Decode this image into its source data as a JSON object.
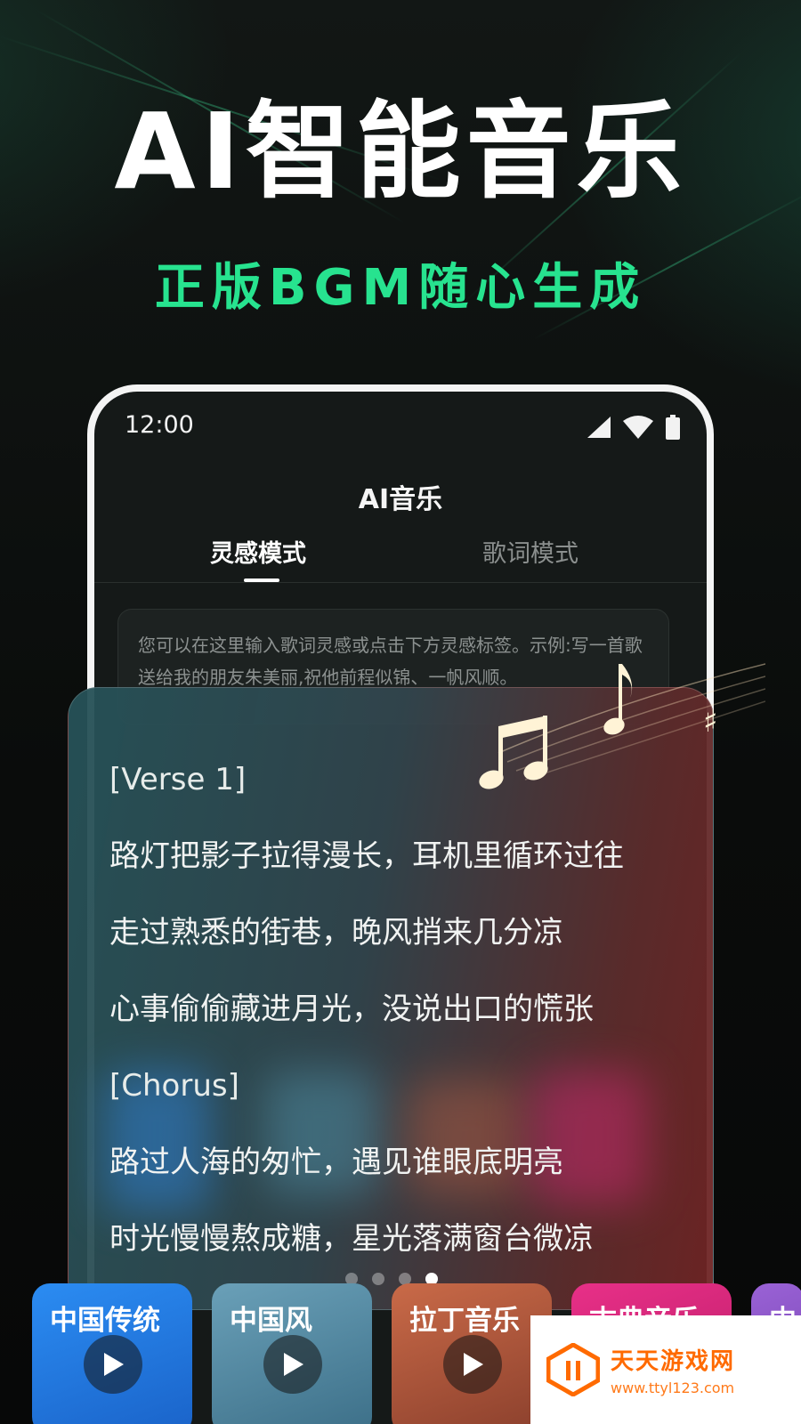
{
  "hero": {
    "title": "AI智能音乐",
    "subtitle": "正版BGM随心生成"
  },
  "status_bar": {
    "time": "12:00",
    "icons": [
      "signal-icon",
      "wifi-icon",
      "battery-icon"
    ]
  },
  "app": {
    "title": "AI音乐",
    "tabs": [
      {
        "label": "灵感模式",
        "active": true
      },
      {
        "label": "歌词模式",
        "active": false
      }
    ],
    "input_placeholder": "您可以在这里输入歌词灵感或点击下方灵感标签。示例:写一首歌送给我的朋友朱美丽,祝他前程似锦、一帆风顺。"
  },
  "lyrics": {
    "lines": [
      "[Verse 1]",
      "路灯把影子拉得漫长，耳机里循环过往",
      "走过熟悉的街巷，晚风捎来几分凉",
      "心事偷偷藏进月光，没说出口的慌张",
      "[Chorus]",
      "路过人海的匆忙，遇见谁眼底明亮",
      "时光慢慢熬成糖，星光落满窗台微凉"
    ]
  },
  "pagination": {
    "count": 4,
    "active_index": 3
  },
  "genres": [
    {
      "label": "中国传统",
      "color": "#1f7fe8"
    },
    {
      "label": "中国风",
      "color": "#4f87a3"
    },
    {
      "label": "拉丁音乐",
      "color": "#b85a3c"
    },
    {
      "label": "古典音乐",
      "color": "#e0237e"
    },
    {
      "label": "中",
      "color": "#8b55c9"
    }
  ],
  "watermark": {
    "name": "天天游戏网",
    "url": "www.ttyl123.com"
  },
  "colors": {
    "accent_green": "#27e38f",
    "background": "#0b0e0d",
    "phone_frame": "#f4f4f4"
  }
}
